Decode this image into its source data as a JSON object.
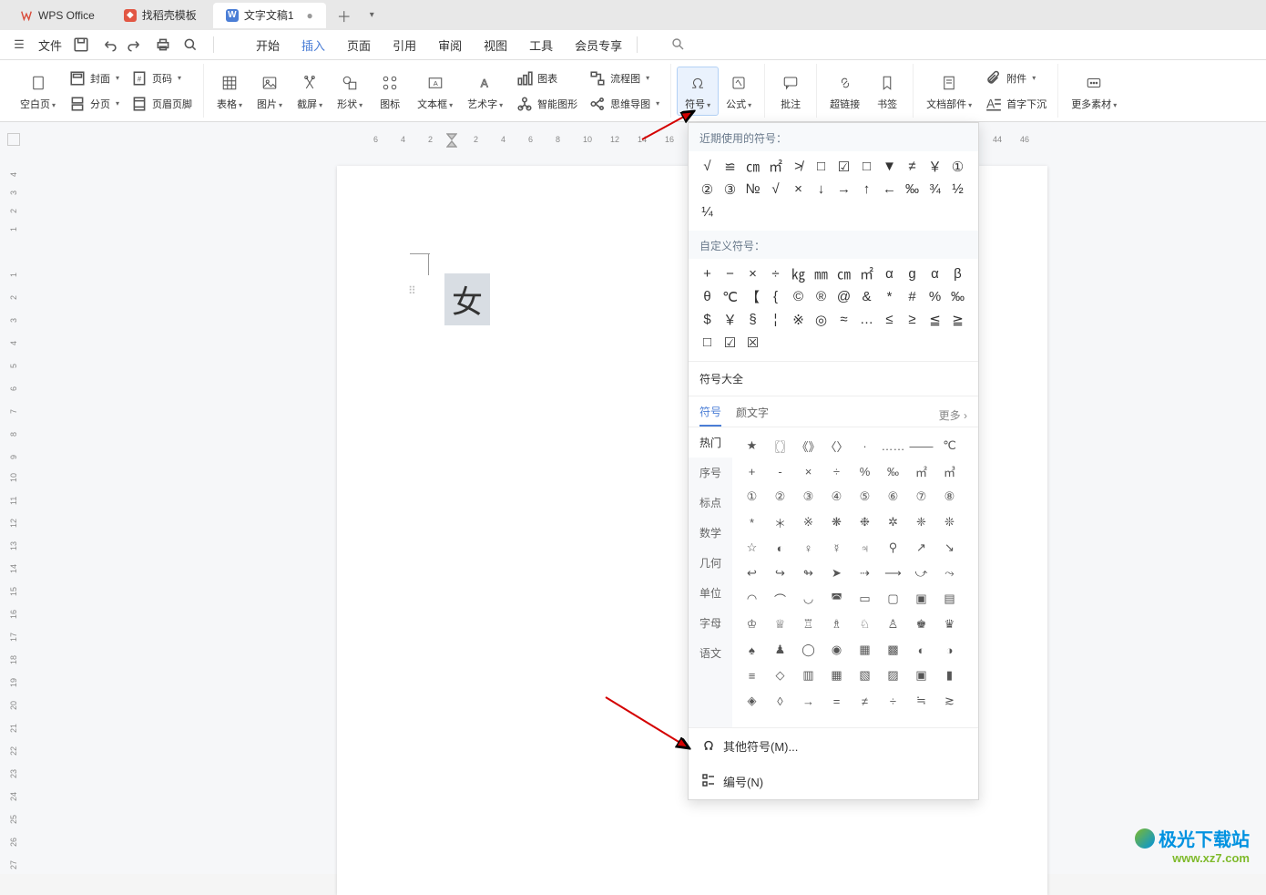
{
  "tabs": {
    "wps": "WPS Office",
    "templates": "找稻壳模板",
    "doc": "文字文稿1"
  },
  "menubar": {
    "file": "文件",
    "tabs": [
      "开始",
      "插入",
      "页面",
      "引用",
      "审阅",
      "视图",
      "工具",
      "会员专享"
    ],
    "active_index": 1
  },
  "ribbon": {
    "blank_page": "空白页",
    "cover": "封面",
    "page_num": "页码",
    "page_break": "分页",
    "header_footer": "页眉页脚",
    "table": "表格",
    "picture": "图片",
    "screenshot": "截屏",
    "shape": "形状",
    "icon": "图标",
    "textbox": "文本框",
    "wordart": "艺术字",
    "chart": "图表",
    "flowchart": "流程图",
    "smartart": "智能图形",
    "mindmap": "思维导图",
    "symbol": "符号",
    "equation": "公式",
    "comment": "批注",
    "hyperlink": "超链接",
    "bookmark": "书签",
    "doc_parts": "文档部件",
    "attachment": "附件",
    "drop_cap": "首字下沉",
    "more_assets": "更多素材"
  },
  "ruler": {
    "hticks": [
      "6",
      "4",
      "2",
      "2",
      "4",
      "6",
      "8",
      "10",
      "12",
      "14",
      "16",
      "44",
      "46"
    ]
  },
  "document": {
    "text": "女"
  },
  "symbol_panel": {
    "recent_label": "近期使用的符号：",
    "recent": [
      "√",
      "≌",
      "㎝",
      "㎡",
      "≯",
      "□",
      "☑",
      "□",
      "▼",
      "≠",
      "￥",
      "①",
      "②",
      "③",
      "№",
      "√",
      "×",
      "↓",
      "→",
      "↑",
      "←",
      "‰",
      "¾",
      "½",
      "¼"
    ],
    "custom_label": "自定义符号：",
    "custom": [
      "+",
      "−",
      "×",
      "÷",
      "㎏",
      "㎜",
      "㎝",
      "㎡",
      "α",
      "g",
      "α",
      "β",
      "θ",
      "℃",
      "【",
      "{",
      "©",
      "®",
      "@",
      "&",
      "*",
      "#",
      "%",
      "‰",
      "$",
      "￥",
      "§",
      "¦",
      "※",
      "◎",
      "≈",
      "…",
      "≤",
      "≥",
      "≦",
      "≧",
      "□",
      "☑",
      "☒"
    ],
    "all_label": "符号大全",
    "tab_symbol": "符号",
    "tab_emoji": "颜文字",
    "more": "更多",
    "categories": [
      "热门",
      "序号",
      "标点",
      "数学",
      "几何",
      "单位",
      "字母",
      "语文"
    ],
    "grid": [
      "★",
      "〖〗",
      "《》",
      "〈〉",
      "·",
      "……",
      "——",
      "℃",
      "+",
      "-",
      "×",
      "÷",
      "%",
      "‰",
      "㎡",
      "㎥",
      "①",
      "②",
      "③",
      "④",
      "⑤",
      "⑥",
      "⑦",
      "⑧",
      "*",
      "＊",
      "※",
      "❋",
      "❉",
      "✲",
      "❈",
      "❊",
      "☆",
      "◐",
      "♀",
      "☿",
      "♃",
      "⚲",
      "↗",
      "↘",
      "↩",
      "↪",
      "↬",
      "➤",
      "⇢",
      "⟶",
      "⤻",
      "⤳",
      "◠",
      "⌒",
      "◡",
      "◚",
      "▭",
      "▢",
      "▣",
      "▤",
      "♔",
      "♕",
      "♖",
      "♗",
      "♘",
      "♙",
      "♚",
      "♛",
      "♠",
      "♟",
      "◯",
      "◉",
      "▦",
      "▩",
      "◐",
      "◑",
      "≡",
      "◇",
      "▥",
      "▦",
      "▧",
      "▨",
      "▣",
      "▮",
      "◈",
      "◊",
      "→",
      "=",
      "≠",
      "÷",
      "≒",
      "≳"
    ],
    "other_symbols": "其他符号(M)...",
    "numbering": "编号(N)"
  },
  "watermark": {
    "line1": "极光下载站",
    "line2": "www.xz7.com"
  }
}
